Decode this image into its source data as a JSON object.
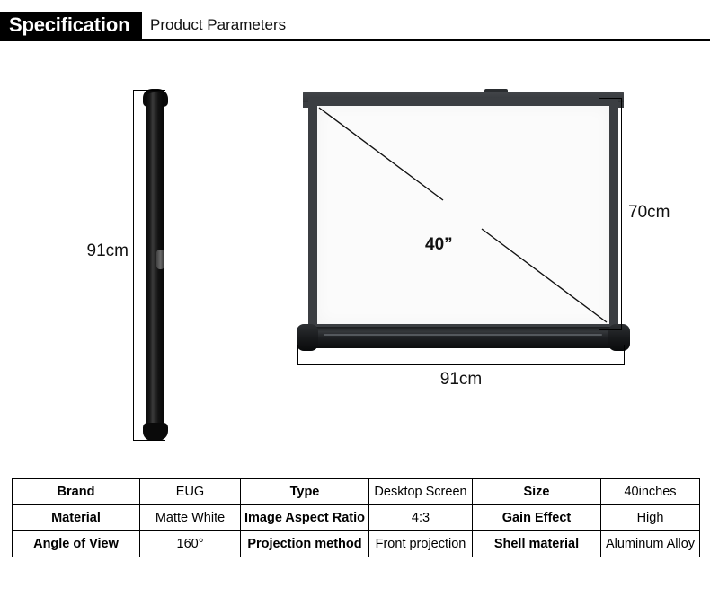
{
  "header": {
    "badge_label": "Specification",
    "subtitle": "Product Parameters"
  },
  "illustration": {
    "side_view": {
      "name": "folded-screen-side-profile",
      "height_label": "91cm"
    },
    "front_view": {
      "name": "desktop-projection-screen-front",
      "diagonal_label": "40”",
      "height_label": "70cm",
      "width_label": "91cm"
    }
  },
  "spec_table": {
    "rows": [
      [
        {
          "text": "Brand",
          "type": "key"
        },
        {
          "text": "EUG",
          "type": "value"
        },
        {
          "text": "Type",
          "type": "key"
        },
        {
          "text": "Desktop Screen",
          "type": "value"
        },
        {
          "text": "Size",
          "type": "key"
        },
        {
          "text": "40inches",
          "type": "value"
        }
      ],
      [
        {
          "text": "Material",
          "type": "key"
        },
        {
          "text": "Matte White",
          "type": "value"
        },
        {
          "text": "Image Aspect Ratio",
          "type": "key"
        },
        {
          "text": "4:3",
          "type": "value"
        },
        {
          "text": "Gain Effect",
          "type": "key"
        },
        {
          "text": "High",
          "type": "value"
        }
      ],
      [
        {
          "text": "Angle of View",
          "type": "key"
        },
        {
          "text": "160°",
          "type": "value"
        },
        {
          "text": "Projection method",
          "type": "key"
        },
        {
          "text": "Front projection",
          "type": "value"
        },
        {
          "text": "Shell material",
          "type": "key"
        },
        {
          "text": "Aluminum Alloy",
          "type": "value"
        }
      ]
    ]
  },
  "colors": {
    "header_block": "#000000",
    "frame_dark": "#3b3e42",
    "screen_white": "#fbfbfb",
    "casing_black": "#0a0a0a",
    "line": "#000000"
  }
}
